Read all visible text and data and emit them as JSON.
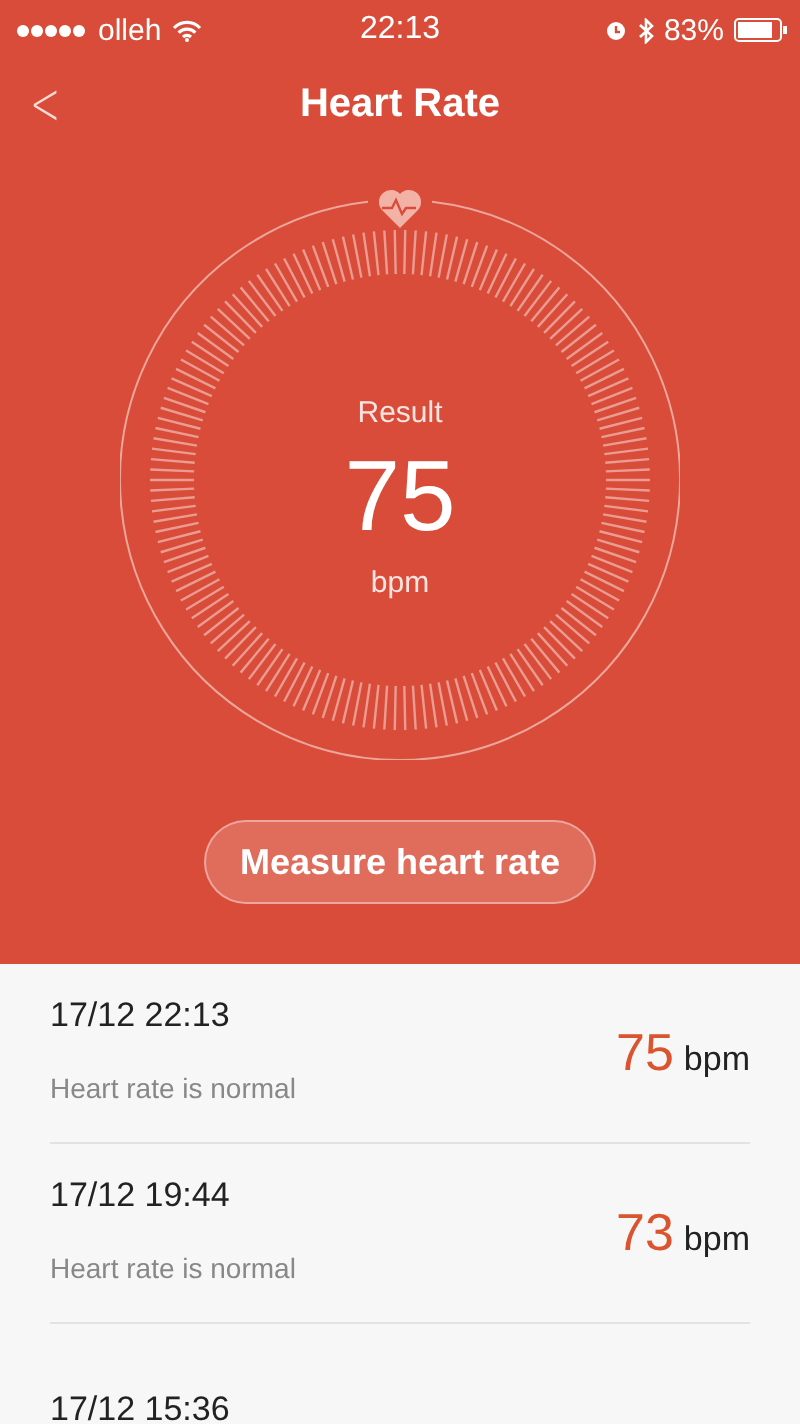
{
  "status_bar": {
    "carrier": "olleh",
    "time": "22:13",
    "battery": "83%"
  },
  "header": {
    "back": "<",
    "title": "Heart Rate"
  },
  "gauge": {
    "label": "Result",
    "value": "75",
    "unit": "bpm"
  },
  "measure_button": "Measure heart rate",
  "records": [
    {
      "time": "17/12 22:13",
      "status": "Heart rate is normal",
      "value": "75",
      "unit": "bpm"
    },
    {
      "time": "17/12 19:44",
      "status": "Heart rate is normal",
      "value": "73",
      "unit": "bpm"
    },
    {
      "time": "17/12 15:36"
    }
  ]
}
